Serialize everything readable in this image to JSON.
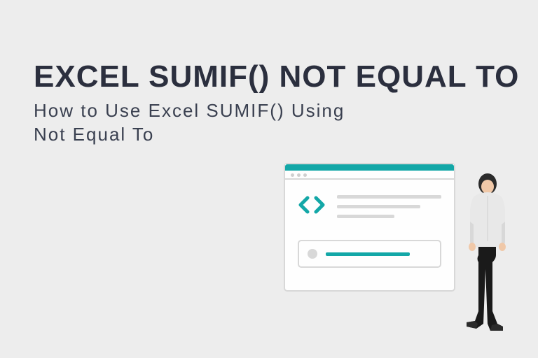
{
  "heading": {
    "title": "EXCEL SUMIF() NOT EQUAL TO",
    "subtitle": "How to Use Excel SUMIF() Using Not Equal To"
  },
  "illustration": {
    "browser_icon": "code-brackets",
    "accent_color": "#13a7a7",
    "person": "standing-figure"
  }
}
